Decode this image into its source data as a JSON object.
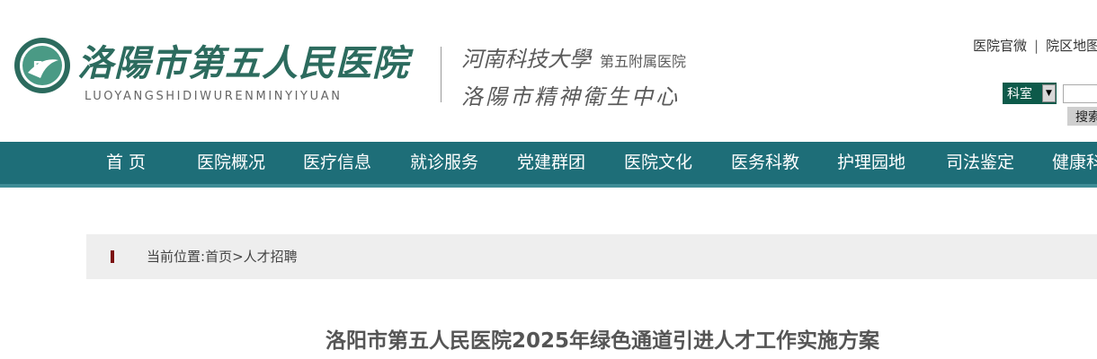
{
  "header": {
    "logo_icon": "hospital-seal-icon",
    "brand_name": "洛陽市第五人民医院",
    "brand_pinyin": "LUOYANGSHIDIWURENMINYIYUAN",
    "affiliation_1": "河南科技大學",
    "affiliation_1_sub": "第五附属医院",
    "affiliation_2": "洛陽市精神衛生中心",
    "top_links": [
      "医院官微",
      "院区地图"
    ],
    "search": {
      "category": "科室",
      "input_value": "",
      "button_label": "搜索"
    }
  },
  "nav": {
    "items": [
      "首 页",
      "医院概况",
      "医疗信息",
      "就诊服务",
      "党建群团",
      "医院文化",
      "医务科教",
      "护理园地",
      "司法鉴定",
      "健康科普"
    ]
  },
  "breadcrumb": {
    "prefix": "当前位置:",
    "home": "首页",
    "separator": ">",
    "current": "人才招聘"
  },
  "article": {
    "title": "洛阳市第五人民医院2025年绿色通道引进人才工作实施方案"
  },
  "colors": {
    "nav_bg": "#1e6e78",
    "brand_green": "#2c6b5e",
    "search_select_bg": "#0d5a4a",
    "breadcrumb_marker": "#7b1010"
  }
}
